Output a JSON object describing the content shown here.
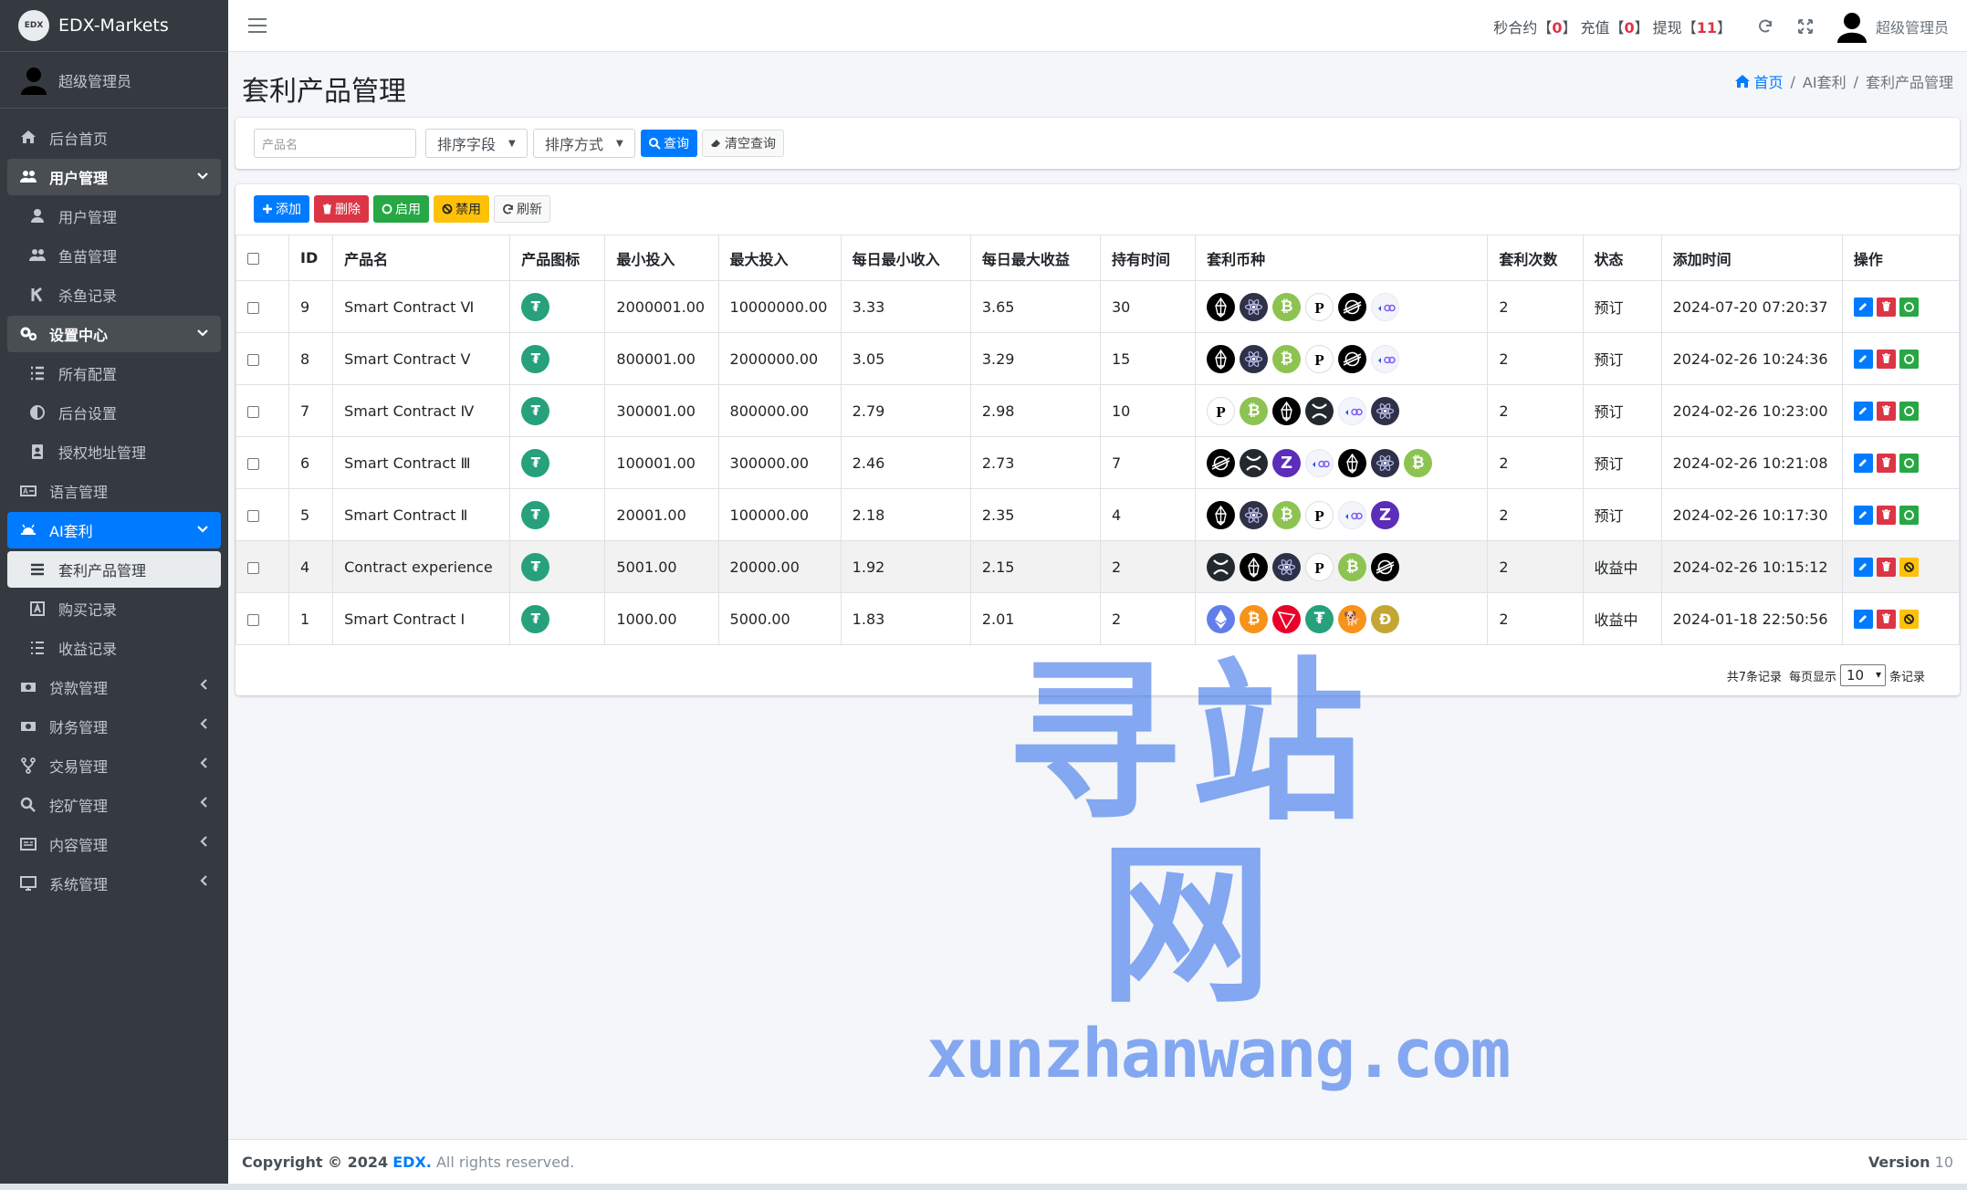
{
  "brand": {
    "name": "EDX-Markets",
    "logo_text": "EDX"
  },
  "user": {
    "name": "超级管理员"
  },
  "sidebar": {
    "items": [
      {
        "label": "后台首页",
        "icon": "home-icon",
        "type": "top"
      },
      {
        "label": "用户管理",
        "icon": "users-icon",
        "type": "group"
      },
      {
        "label": "用户管理",
        "icon": "user-icon",
        "type": "sub"
      },
      {
        "label": "鱼苗管理",
        "icon": "users-icon",
        "type": "sub"
      },
      {
        "label": "杀鱼记录",
        "icon": "k-icon",
        "type": "sub"
      },
      {
        "label": "设置中心",
        "icon": "cogs-icon",
        "type": "group"
      },
      {
        "label": "所有配置",
        "icon": "list-icon",
        "type": "sub"
      },
      {
        "label": "后台设置",
        "icon": "adjust-icon",
        "type": "sub"
      },
      {
        "label": "授权地址管理",
        "icon": "address-card-icon",
        "type": "sub"
      },
      {
        "label": "语言管理",
        "icon": "language-icon",
        "type": "top"
      },
      {
        "label": "AI套利",
        "icon": "android-icon",
        "type": "blue"
      },
      {
        "label": "套利产品管理",
        "icon": "bars-icon",
        "type": "active-sub"
      },
      {
        "label": "购买记录",
        "icon": "font-icon",
        "type": "sub"
      },
      {
        "label": "收益记录",
        "icon": "list-ol-icon",
        "type": "sub"
      },
      {
        "label": "贷款管理",
        "icon": "money-icon",
        "type": "collapsed"
      },
      {
        "label": "财务管理",
        "icon": "money-icon",
        "type": "collapsed"
      },
      {
        "label": "交易管理",
        "icon": "code-fork-icon",
        "type": "collapsed"
      },
      {
        "label": "挖矿管理",
        "icon": "search-icon",
        "type": "collapsed"
      },
      {
        "label": "内容管理",
        "icon": "newspaper-icon",
        "type": "collapsed"
      },
      {
        "label": "系统管理",
        "icon": "desktop-icon",
        "type": "collapsed"
      }
    ]
  },
  "topbar": {
    "stats": [
      {
        "label": "秒合约",
        "value": "0"
      },
      {
        "label": "充值",
        "value": "0"
      },
      {
        "label": "提现",
        "value": "11"
      }
    ],
    "username": "超级管理员"
  },
  "page": {
    "title": "套利产品管理",
    "breadcrumb": [
      "首页",
      "AI套利",
      "套利产品管理"
    ]
  },
  "filter": {
    "name_placeholder": "产品名",
    "sort_field": "排序字段",
    "sort_order": "排序方式",
    "search_label": "查询",
    "clear_label": "清空查询"
  },
  "toolbar": {
    "add": "添加",
    "delete": "删除",
    "enable": "启用",
    "disable": "禁用",
    "refresh": "刷新"
  },
  "table": {
    "headers": [
      "",
      "ID",
      "产品名",
      "产品图标",
      "最小投入",
      "最大投入",
      "每日最小收入",
      "每日最大收益",
      "持有时间",
      "套利币种",
      "套利次数",
      "状态",
      "添加时间",
      "操作"
    ],
    "rows": [
      {
        "id": "9",
        "name": "Smart Contract Ⅵ",
        "min": "2000001.00",
        "max": "10000000.00",
        "dmin": "3.33",
        "dmax": "3.65",
        "hold": "30",
        "coins": [
          "eos",
          "atom",
          "btc",
          "dot",
          "xlm",
          "link"
        ],
        "times": "2",
        "status": "预订",
        "time": "2024-07-20 07:20:37",
        "toggle": "enable"
      },
      {
        "id": "8",
        "name": "Smart Contract Ⅴ",
        "min": "800001.00",
        "max": "2000000.00",
        "dmin": "3.05",
        "dmax": "3.29",
        "hold": "15",
        "coins": [
          "eos",
          "atom",
          "btc",
          "dot",
          "xlm",
          "link"
        ],
        "times": "2",
        "status": "预订",
        "time": "2024-02-26 10:24:36",
        "toggle": "enable"
      },
      {
        "id": "7",
        "name": "Smart Contract Ⅳ",
        "min": "300001.00",
        "max": "800000.00",
        "dmin": "2.79",
        "dmax": "2.98",
        "hold": "10",
        "coins": [
          "dot",
          "btc",
          "eos",
          "xrp",
          "link",
          "atom"
        ],
        "times": "2",
        "status": "预订",
        "time": "2024-02-26 10:23:00",
        "toggle": "enable"
      },
      {
        "id": "6",
        "name": "Smart Contract Ⅲ",
        "min": "100001.00",
        "max": "300000.00",
        "dmin": "2.46",
        "dmax": "2.73",
        "hold": "7",
        "coins": [
          "xlm",
          "xrp",
          "zec",
          "link",
          "eos",
          "atom",
          "btc"
        ],
        "times": "2",
        "status": "预订",
        "time": "2024-02-26 10:21:08",
        "toggle": "enable"
      },
      {
        "id": "5",
        "name": "Smart Contract Ⅱ",
        "min": "20001.00",
        "max": "100000.00",
        "dmin": "2.18",
        "dmax": "2.35",
        "hold": "4",
        "coins": [
          "eos",
          "atom",
          "btc",
          "dot",
          "link",
          "zec"
        ],
        "times": "2",
        "status": "预订",
        "time": "2024-02-26 10:17:30",
        "toggle": "enable"
      },
      {
        "id": "4",
        "name": "Contract experience",
        "min": "5001.00",
        "max": "20000.00",
        "dmin": "1.92",
        "dmax": "2.15",
        "hold": "2",
        "coins": [
          "xrp",
          "eos",
          "atom",
          "dot",
          "btc",
          "xlm"
        ],
        "times": "2",
        "status": "收益中",
        "time": "2024-02-26 10:15:12",
        "toggle": "disable"
      },
      {
        "id": "1",
        "name": "Smart Contract Ⅰ",
        "min": "1000.00",
        "max": "5000.00",
        "dmin": "1.83",
        "dmax": "2.01",
        "hold": "2",
        "coins": [
          "eth",
          "bitc",
          "trx",
          "usdt2",
          "shib",
          "doge"
        ],
        "times": "2",
        "status": "收益中",
        "time": "2024-01-18 22:50:56",
        "toggle": "disable"
      }
    ]
  },
  "pager": {
    "total": "共7条记录",
    "per_page_label": "每页显示",
    "per_page": "10",
    "suffix": "条记录"
  },
  "footer": {
    "copyright": "Copyright © 2024",
    "company": "EDX.",
    "rights": "All rights reserved.",
    "version_label": "Version",
    "version": "10"
  },
  "watermark": {
    "cn": "寻站网",
    "url": "xunzhanwang.com"
  },
  "colors": {
    "sidebar": "#343a40",
    "primary": "#007bff",
    "danger": "#dc3545",
    "success": "#28a745",
    "warning": "#ffc107",
    "tether": "#26a17b"
  }
}
